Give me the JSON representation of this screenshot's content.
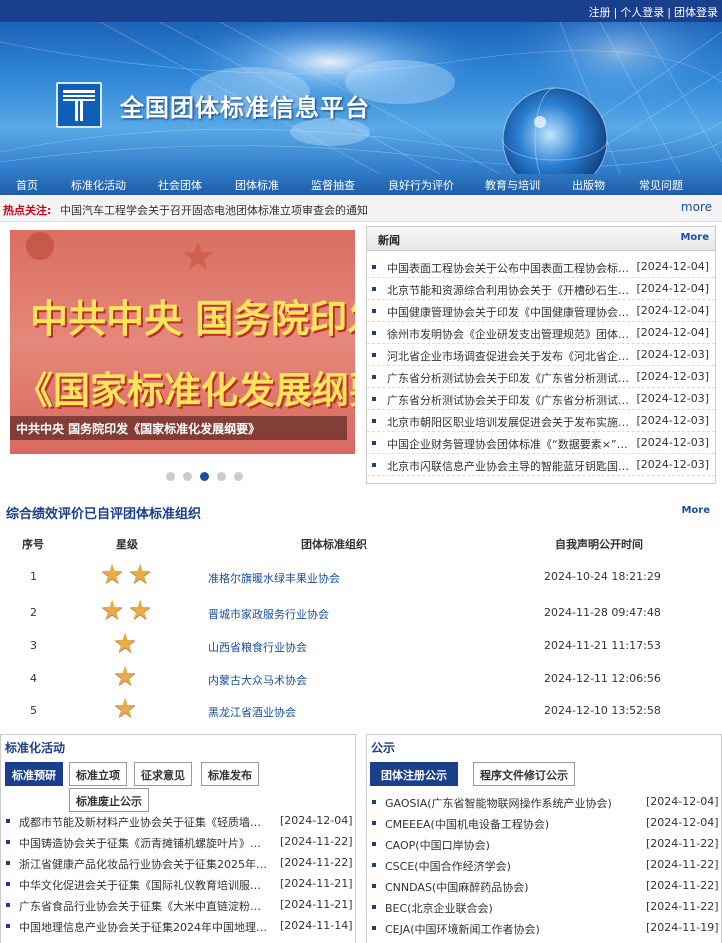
{
  "top_links": [
    "注册",
    "个人登录",
    "团体登录"
  ],
  "site_title": "全国团体标准信息平台",
  "nav": [
    "首页",
    "标准化活动",
    "社会团体",
    "团体标准",
    "监督抽查",
    "良好行为评价",
    "教育与培训",
    "出版物",
    "常见问题"
  ],
  "hot": {
    "label": "热点关注:",
    "text": "中国汽车工程学会关于召开固态电池团体标准立项审查会的通知",
    "more": "more"
  },
  "slider": {
    "line1": "中共中央 国务院印发",
    "line2": "《国家标准化发展纲要》",
    "caption": "中共中央 国务院印发《国家标准化发展纲要》",
    "dot_count": 5,
    "active_dot": 3
  },
  "news": {
    "title": "新闻",
    "more": "More",
    "items": [
      {
        "title": "中国表面工程协会关于公布中国表面工程协会标准…",
        "date": "[2024-12-04]"
      },
      {
        "title": "北京节能和资源综合利用协会关于《开槽砂石生产技…",
        "date": "[2024-12-04]"
      },
      {
        "title": "中国健康管理协会关于印发《中国健康管理协会标准…",
        "date": "[2024-12-04]"
      },
      {
        "title": "徐州市发明协会《企业研发支出管理规范》团体标准…",
        "date": "[2024-12-04]"
      },
      {
        "title": "河北省企业市场调查促进会关于发布《河北省企业市…",
        "date": "[2024-12-03]"
      },
      {
        "title": "广东省分析测试协会关于印发《广东省分析测试协会…",
        "date": "[2024-12-03]"
      },
      {
        "title": "广东省分析测试协会关于印发《广东省分析测试协会…",
        "date": "[2024-12-03]"
      },
      {
        "title": "北京市朝阳区职业培训发展促进会关于发布实施《北…",
        "date": "[2024-12-03]"
      },
      {
        "title": "中国企业财务管理协会团体标准《“数据要素×”…",
        "date": "[2024-12-03]"
      },
      {
        "title": "北京市闪联信息产业协会主导的智能蓝牙钥匙国际标准…",
        "date": "[2024-12-03]"
      }
    ]
  },
  "performance": {
    "title": "综合绩效评价已自评团体标准组织",
    "more": "More",
    "headers": [
      "序号",
      "星级",
      "团体标准组织",
      "自我声明公开时间"
    ],
    "rows": [
      {
        "no": "1",
        "stars": 2,
        "org": "准格尔旗暖水绿丰果业协会",
        "time": "2024-10-24 18:21:29"
      },
      {
        "no": "2",
        "stars": 2,
        "org": "晋城市家政服务行业协会",
        "time": "2024-11-28 09:47:48"
      },
      {
        "no": "3",
        "stars": 1,
        "org": "山西省粮食行业协会",
        "time": "2024-11-21 11:17:53"
      },
      {
        "no": "4",
        "stars": 1,
        "org": "内蒙古大众马术协会",
        "time": "2024-12-11 12:06:56"
      },
      {
        "no": "5",
        "stars": 1,
        "org": "黑龙江省酒业协会",
        "time": "2024-12-10 13:52:58"
      }
    ]
  },
  "activities": {
    "title": "标准化活动",
    "tabs": [
      "标准预研",
      "标准立项",
      "征求意见",
      "标准发布",
      "标准废止公示"
    ],
    "items": [
      {
        "title": "成都市节能及新材料产业协会关于征集《轻质墙体保…",
        "date": "[2024-12-04]"
      },
      {
        "title": "中国铸造协会关于征集《沥青摊铺机螺旋叶片》等八…",
        "date": "[2024-11-22]"
      },
      {
        "title": "浙江省健康产品化妆品行业协会关于征集2025年…",
        "date": "[2024-11-22]"
      },
      {
        "title": "中华文化促进会关于征集《国际礼仪教育培训服务规…",
        "date": "[2024-11-21]"
      },
      {
        "title": "广东省食品行业协会关于征集《大米中直链淀粉含量…",
        "date": "[2024-11-21]"
      },
      {
        "title": "中国地理信息产业协会关于征集2024年中国地理…",
        "date": "[2024-11-14]"
      }
    ]
  },
  "notice": {
    "title": "公示",
    "tabs": [
      "团体注册公示",
      "程序文件修订公示"
    ],
    "items": [
      {
        "title": "GAOSIA(广东省智能物联网操作系统产业协会)",
        "date": "[2024-12-04]"
      },
      {
        "title": "CMEEEA(中国机电设备工程协会)",
        "date": "[2024-12-04]"
      },
      {
        "title": "CAOP(中国口岸协会)",
        "date": "[2024-11-22]"
      },
      {
        "title": "CSCE(中国合作经济学会)",
        "date": "[2024-11-22]"
      },
      {
        "title": "CNNDAS(中国麻醉药品协会)",
        "date": "[2024-11-22]"
      },
      {
        "title": "BEC(北京企业联合会)",
        "date": "[2024-11-22]"
      },
      {
        "title": "CEJA(中国环境新闻工作者协会)",
        "date": "[2024-11-19]"
      }
    ]
  }
}
